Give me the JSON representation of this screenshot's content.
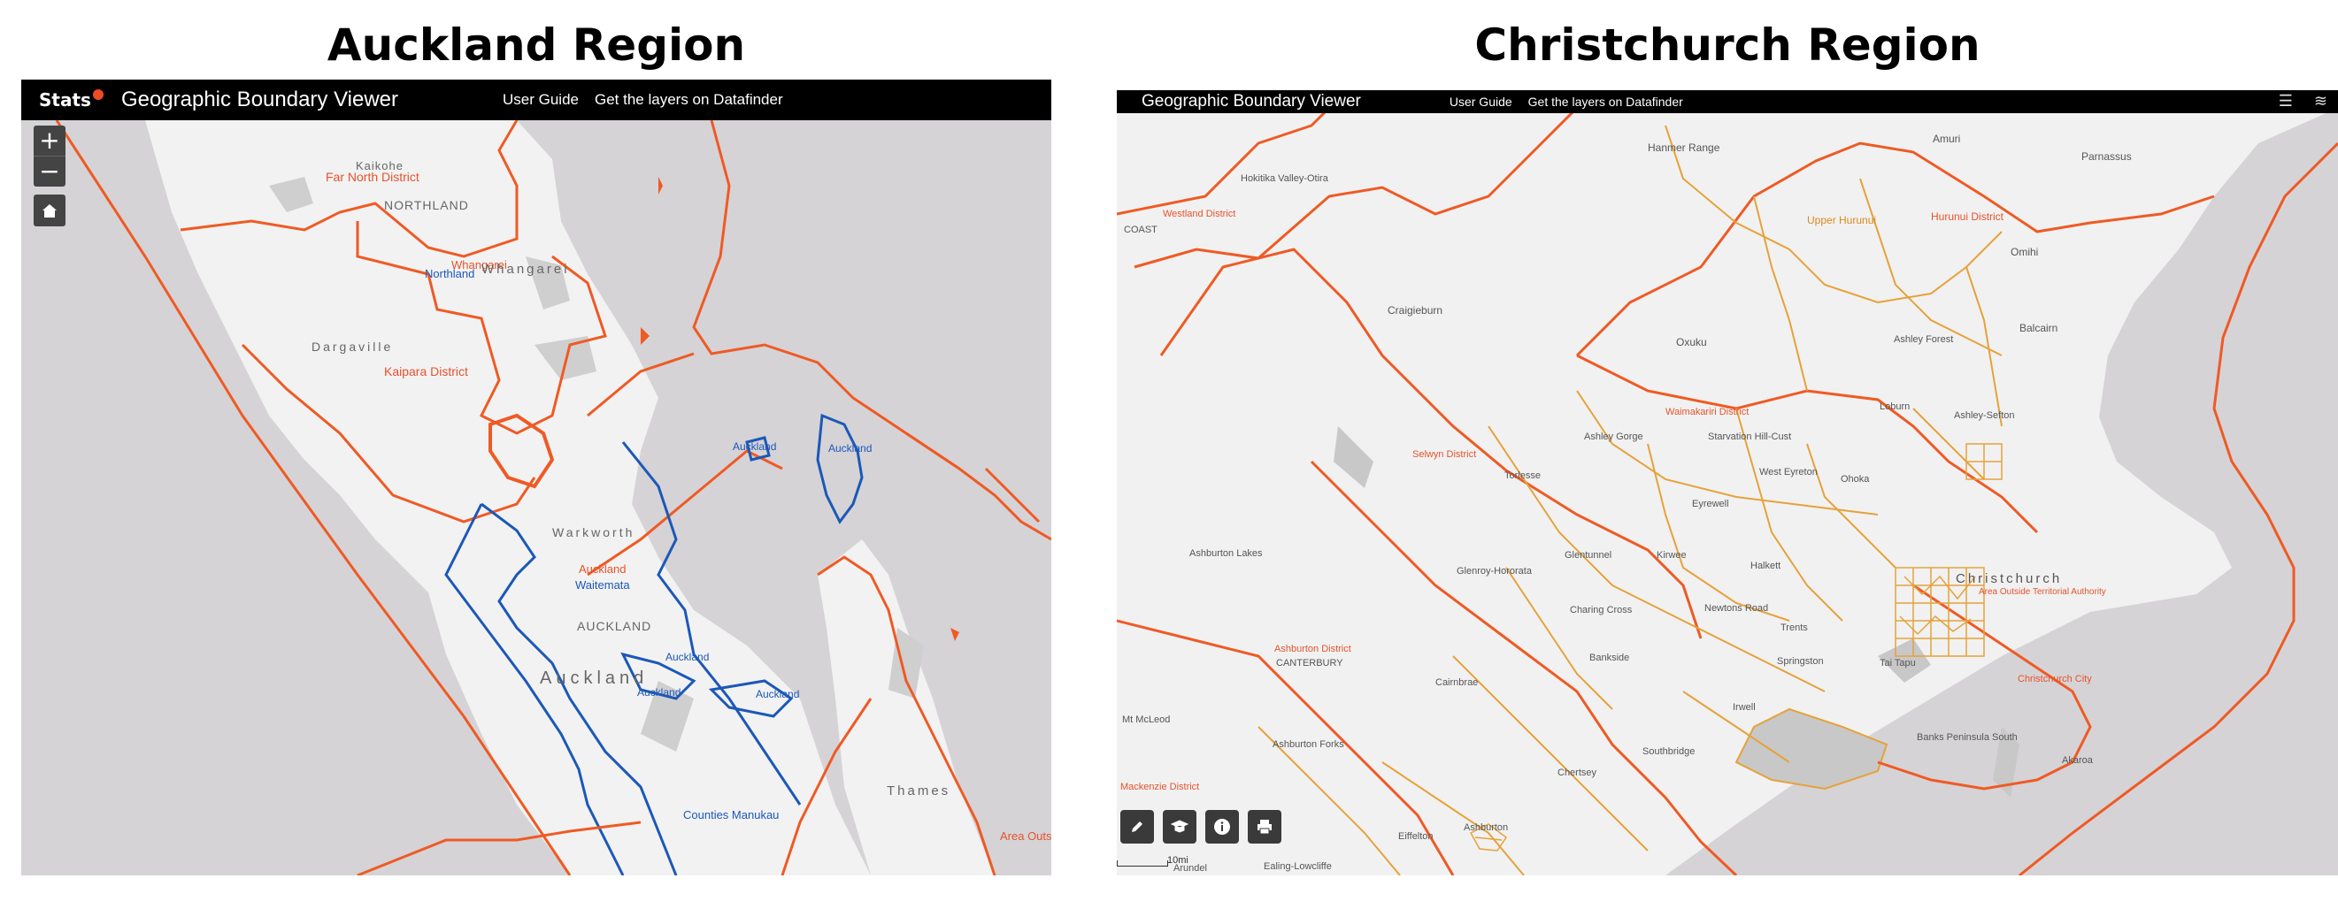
{
  "panels": {
    "left": {
      "title": "Auckland Region",
      "logo": "Stats",
      "app_title": "Geographic Boundary Viewer",
      "nav": [
        "User Guide",
        "Get the layers on Datafinder"
      ],
      "labels": {
        "kaikohe": "Kaikohe",
        "far_north": "Far North District",
        "northland_grey": "NORTHLAND",
        "whangarei_red": "Whangarei",
        "whangarei_grey": "Whangarei",
        "northland_blue": "Northland",
        "dargaville": "Dargaville",
        "kaipara": "Kaipara District",
        "auckland_blue_1": "Auckland",
        "auckland_blue_2": "Auckland",
        "warkworth": "Warkworth",
        "auckland_red": "Auckland",
        "waitemata": "Waitemata",
        "auckland_grey_upper": "AUCKLAND",
        "auckland_big": "Auckland",
        "auckland_blue_3": "Auckland",
        "auckland_blue_4": "Auckland",
        "auckland_blue_5": "Auckland",
        "thames": "Thames",
        "counties": "Counties Manukau",
        "area_outside": "Area Outsi"
      }
    },
    "right": {
      "title": "Christchurch Region",
      "app_title": "Geographic Boundary Viewer",
      "nav": [
        "User Guide",
        "Get the layers on Datafinder"
      ],
      "labels": {
        "hanmer": "Hanmer Range",
        "amuri": "Amuri",
        "parnassus": "Parnassus",
        "hokitika": "Hokitika Valley-Otira",
        "upper_hurunui": "Upper Hurunui",
        "hurunui_district": "Hurunui District",
        "westland": "Westland District",
        "coast": "COAST",
        "omihi": "Omihi",
        "craigieburn": "Craigieburn",
        "oxford": "Oxuku",
        "ashley_forest": "Ashley Forest",
        "balcairn": "Balcairn",
        "waimakariri": "Waimakariri District",
        "loburn": "Loburn",
        "ashley_sefton": "Ashley-Sefton",
        "ashley_gorge": "Ashley Gorge",
        "starvation": "Starvation Hill-Cust",
        "selwyn": "Selwyn District",
        "torlesse": "Torlesse",
        "west_eyreton": "West Eyreton",
        "ohoka": "Ohoka",
        "eyrewell": "Eyrewell",
        "ashburton_lakes": "Ashburton Lakes",
        "glentunnel": "Glentunnel",
        "kirwee": "Kirwee",
        "halkett": "Halkett",
        "christchurch": "Christchurch",
        "outside_ta": "Area Outside Territorial Authority",
        "glenroy": "Glenroy-Hororata",
        "charing": "Charing Cross",
        "newtons": "Newtons Road",
        "trents": "Trents",
        "ashburton_district": "Ashburton District",
        "canterbury": "CANTERBURY",
        "bankside": "Bankside",
        "springston": "Springston",
        "tai_tapu": "Tai Tapu",
        "christchurch_city": "Christchurch City",
        "cairnbrae": "Cairnbrae",
        "irwell": "Irwell",
        "banks_peninsula": "Banks Peninsula South",
        "akaroa": "Akaroa",
        "mount_mcleod": "Mt McLeod",
        "ashburton_forks": "Ashburton Forks",
        "southbridge": "Southbridge",
        "chertsey": "Chertsey",
        "mackenzie": "Mackenzie District",
        "ashburton": "Ashburton",
        "eiffelton": "Eiffelton",
        "ealing": "Ealing-Lowcliffe",
        "arundel": "Arundel",
        "scale": "10mi"
      }
    }
  },
  "colors": {
    "land": "#f2f2f2",
    "sea": "#d5d3d6",
    "boundary_red": "#ef5a24",
    "boundary_blue": "#1b58b8",
    "boundary_orange": "#e6a23a",
    "topbar": "#000000"
  },
  "icons": {
    "zoom_in": "plus-icon",
    "zoom_out": "minus-icon",
    "home": "home-icon",
    "draw": "pencil-icon",
    "select": "graduation-cap-icon",
    "info": "info-icon",
    "print": "printer-icon",
    "legend": "list-icon",
    "layers": "layers-icon"
  }
}
